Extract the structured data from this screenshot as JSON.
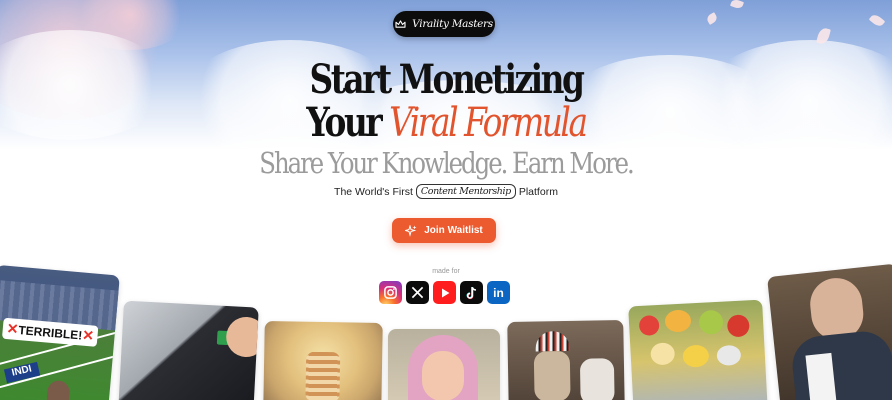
{
  "brand": {
    "name": "Virality Masters",
    "badge_icon": "crown-icon"
  },
  "hero": {
    "headline_line1": "Start Monetizing",
    "headline_line2_prefix": "Your",
    "headline_line2_accent": "Viral Formula",
    "subheadline": "Share Your Knowledge. Earn More.",
    "tagline_before": "The World's First",
    "tagline_highlight": "Content Mentorship",
    "tagline_after": "Platform",
    "accent_color": "#e2542d"
  },
  "cta": {
    "label": "Join Waitlist",
    "icon": "sparkle-icon",
    "color": "#ec5a2f"
  },
  "platforms": {
    "label": "made for",
    "items": [
      {
        "name": "Instagram",
        "icon": "instagram-icon"
      },
      {
        "name": "X",
        "icon": "x-icon"
      },
      {
        "name": "YouTube",
        "icon": "youtube-icon"
      },
      {
        "name": "TikTok",
        "icon": "tiktok-icon"
      },
      {
        "name": "LinkedIn",
        "icon": "linkedin-icon"
      }
    ]
  },
  "video_cards": [
    {
      "name": "football-stadium",
      "overlay_text": "TERRIBLE!"
    },
    {
      "name": "screen-installation"
    },
    {
      "name": "jelly-skeleton"
    },
    {
      "name": "pink-hood-person"
    },
    {
      "name": "dogs-headdress"
    },
    {
      "name": "fruit-platter"
    },
    {
      "name": "man-talking"
    }
  ]
}
